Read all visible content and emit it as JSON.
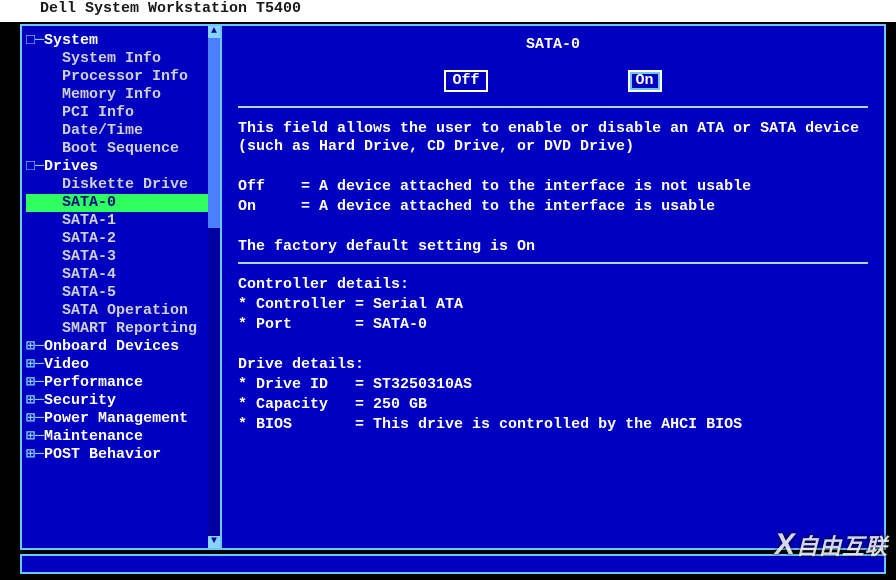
{
  "title": "Dell System Workstation T5400",
  "nav": {
    "groups": [
      {
        "label": "System",
        "expanded": true,
        "items": [
          "System Info",
          "Processor Info",
          "Memory Info",
          "PCI Info",
          "Date/Time",
          "Boot Sequence"
        ]
      },
      {
        "label": "Drives",
        "expanded": true,
        "items": [
          "Diskette Drive",
          "SATA-0",
          "SATA-1",
          "SATA-2",
          "SATA-3",
          "SATA-4",
          "SATA-5",
          "SATA Operation",
          "SMART Reporting"
        ],
        "selected_index": 1
      },
      {
        "label": "Onboard Devices",
        "expanded": false
      },
      {
        "label": "Video",
        "expanded": false
      },
      {
        "label": "Performance",
        "expanded": false
      },
      {
        "label": "Security",
        "expanded": false
      },
      {
        "label": "Power Management",
        "expanded": false
      },
      {
        "label": "Maintenance",
        "expanded": false
      },
      {
        "label": "POST Behavior",
        "expanded": false
      }
    ]
  },
  "panel": {
    "heading": "SATA-0",
    "options": {
      "off": "Off",
      "on": "On",
      "selected": "On"
    },
    "help_intro": "This field allows the user to enable or disable an ATA or SATA device (such as Hard Drive, CD Drive, or DVD Drive)",
    "rows": [
      {
        "k": "Off",
        "v": "= A device attached to the interface is not usable"
      },
      {
        "k": "On",
        "v": "= A device attached to the interface is usable"
      }
    ],
    "default_line_prefix": "The factory default setting is ",
    "default_value": "On",
    "controller": {
      "title": "Controller details:",
      "controller_label": "* Controller = ",
      "controller_value": "Serial ATA",
      "port_label": "* Port       = ",
      "port_value": "SATA-0"
    },
    "drive": {
      "title": "Drive details:",
      "id_label": "* Drive ID   = ",
      "id_value": "ST3250310AS",
      "cap_label": "* Capacity   = ",
      "cap_value": "250 GB",
      "bios_label": "* BIOS       = ",
      "bios_value": "This drive is controlled by the AHCI BIOS"
    }
  },
  "watermark": "自由互联"
}
